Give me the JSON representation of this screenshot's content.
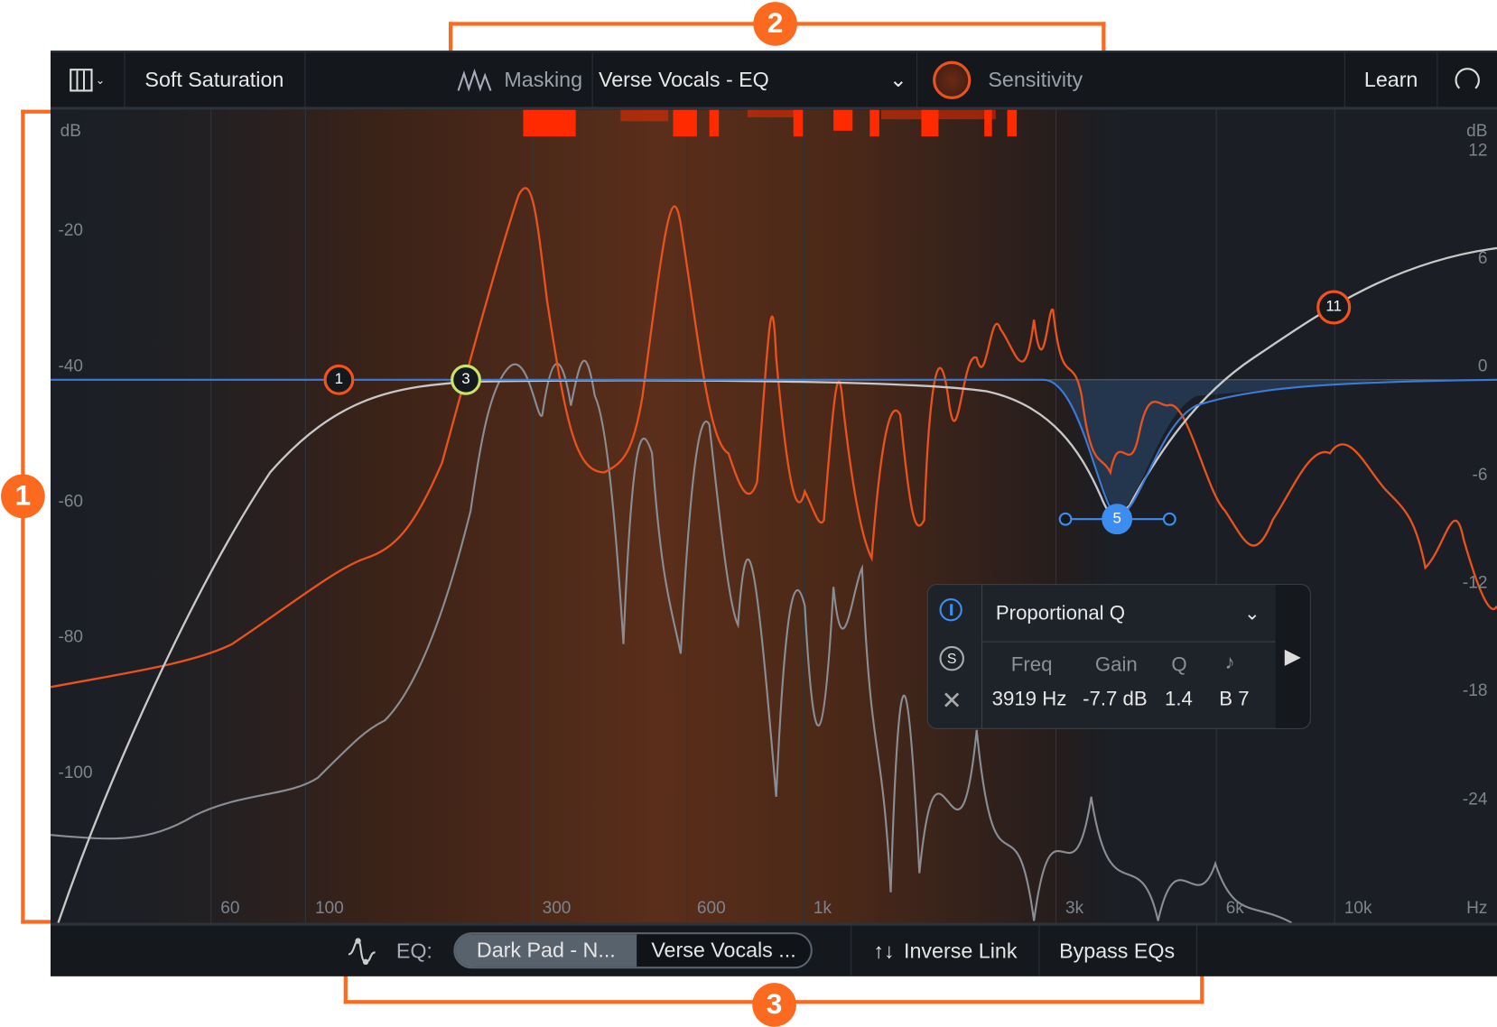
{
  "callouts": [
    "1",
    "2",
    "3"
  ],
  "toolbar": {
    "layout_icon": "columns-icon",
    "soft_saturation": "Soft Saturation",
    "masking": "Masking",
    "masking_source": "Verse Vocals - EQ",
    "sensitivity": "Sensitivity",
    "learn": "Learn",
    "reset_icon": "reset-icon"
  },
  "graph": {
    "left_unit": "dB",
    "left_ticks": [
      "-20",
      "-40",
      "-60",
      "-80",
      "-100"
    ],
    "right_unit": "dB",
    "right_ticks": [
      "12",
      "6",
      "0",
      "-6",
      "-12",
      "-18",
      "-24"
    ],
    "freq_ticks": [
      "60",
      "100",
      "300",
      "600",
      "1k",
      "3k",
      "6k",
      "10k",
      "Hz"
    ],
    "nodes": [
      "1",
      "3",
      "5",
      "11"
    ]
  },
  "band_popup": {
    "mode": "Proportional Q",
    "headers": [
      "Freq",
      "Gain",
      "Q",
      "♪"
    ],
    "values": [
      "3919 Hz",
      "-7.7 dB",
      "1.4",
      "B 7"
    ],
    "solo": "S"
  },
  "bottom": {
    "eq_label": "EQ:",
    "eq_a": "Dark Pad - N...",
    "eq_b": "Verse Vocals ...",
    "inverse_link": "Inverse Link",
    "bypass": "Bypass EQs"
  },
  "colors": {
    "accent": "#fb6a1f",
    "node_orange": "#f3531a",
    "node_green": "#c7e36a",
    "band_blue": "#3b8df0",
    "masking_red": "#ff2a00"
  }
}
